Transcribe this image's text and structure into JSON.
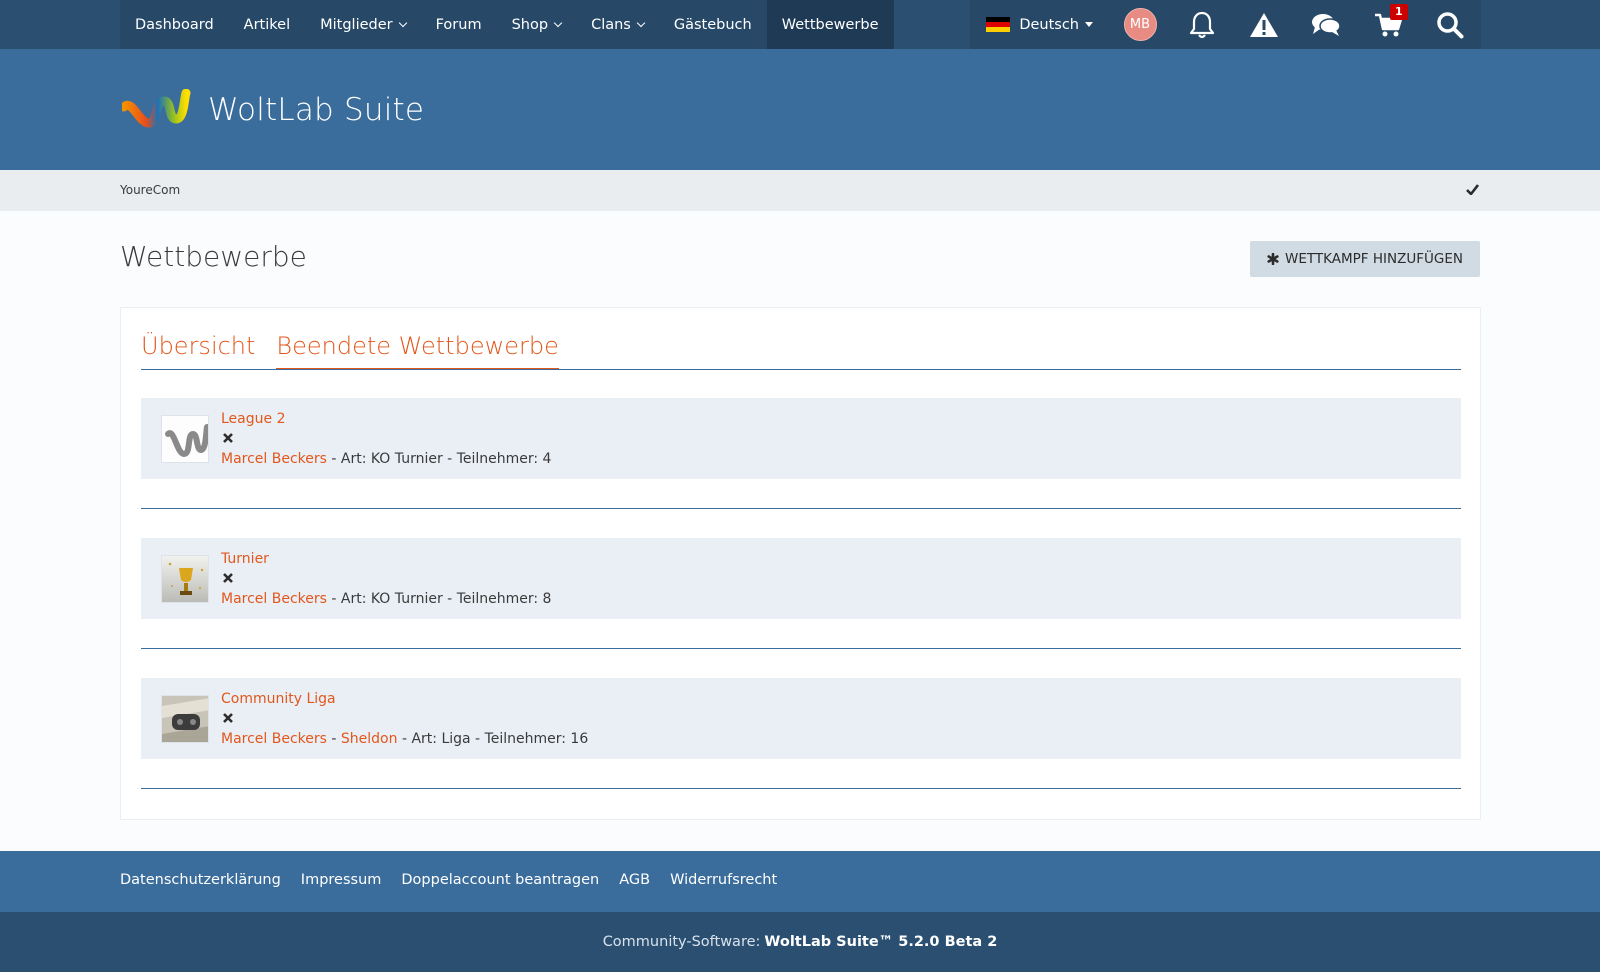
{
  "nav": {
    "items": [
      {
        "label": "Dashboard",
        "dropdown": false,
        "active": false
      },
      {
        "label": "Artikel",
        "dropdown": false,
        "active": false
      },
      {
        "label": "Mitglieder",
        "dropdown": true,
        "active": false
      },
      {
        "label": "Forum",
        "dropdown": false,
        "active": false
      },
      {
        "label": "Shop",
        "dropdown": true,
        "active": false
      },
      {
        "label": "Clans",
        "dropdown": true,
        "active": false
      },
      {
        "label": "Gästebuch",
        "dropdown": false,
        "active": false
      },
      {
        "label": "Wettbewerbe",
        "dropdown": false,
        "active": true
      }
    ],
    "language": "Deutsch",
    "avatar_initials": "MB",
    "cart_count": "1",
    "icons": [
      "bell-icon",
      "warning-icon",
      "chat-icon",
      "cart-icon",
      "search-icon"
    ]
  },
  "header": {
    "logo_text": "WoltLab Suite"
  },
  "breadcrumb": {
    "item": "YoureCom"
  },
  "page": {
    "title": "Wettbewerbe",
    "add_button": "WETTKAMPF HINZUFÜGEN"
  },
  "tabs": [
    {
      "label": "Übersicht",
      "active": false
    },
    {
      "label": "Beendete Wettbewerbe",
      "active": true
    }
  ],
  "competitions": [
    {
      "title": "League 2",
      "organizer": "Marcel Beckers",
      "co_organizer": "",
      "type_text": "Art: KO Turnier",
      "participants_text": "Teilnehmer: 4"
    },
    {
      "title": "Turnier",
      "organizer": "Marcel Beckers",
      "co_organizer": "",
      "type_text": "Art: KO Turnier",
      "participants_text": "Teilnehmer: 8"
    },
    {
      "title": "Community Liga",
      "organizer": "Marcel Beckers",
      "co_organizer": "Sheldon",
      "type_text": "Art: Liga",
      "participants_text": "Teilnehmer: 16"
    }
  ],
  "footer": {
    "links": [
      "Datenschutzerklärung",
      "Impressum",
      "Doppelaccount beantragen",
      "AGB",
      "Widerrufsrecht"
    ],
    "copyright_prefix": "Community-Software:",
    "copyright_product": "WoltLab Suite™ 5.2.0 Beta 2"
  },
  "colors": {
    "accent": "#e2571b",
    "header_blue": "#3a6d9c",
    "nav_dark": "#2b4f71"
  }
}
